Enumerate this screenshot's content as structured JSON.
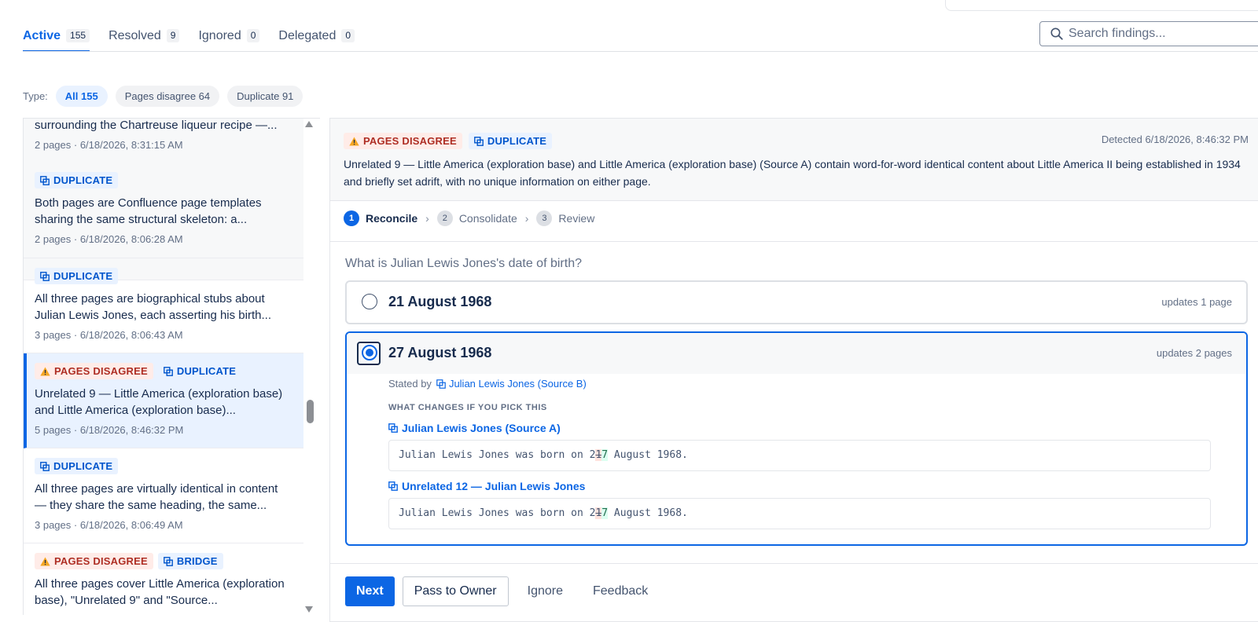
{
  "tabs": [
    {
      "label": "Active",
      "count": "155"
    },
    {
      "label": "Resolved",
      "count": "9"
    },
    {
      "label": "Ignored",
      "count": "0"
    },
    {
      "label": "Delegated",
      "count": "0"
    }
  ],
  "search": {
    "placeholder": "Search findings...",
    "icon": "search-icon"
  },
  "filter": {
    "label": "Type:",
    "chips": [
      "All 155",
      "Pages disagree 64",
      "Duplicate 91"
    ]
  },
  "badges": {
    "duplicate": "DUPLICATE",
    "pages_disagree": "PAGES DISAGREE",
    "bridge": "BRIDGE"
  },
  "list": {
    "items": [
      {
        "text": "surrounding the Chartreuse liqueur recipe —...",
        "meta": "2 pages · 6/18/2026, 8:31:15 AM"
      },
      {
        "text": "Both pages are Confluence page templates sharing the same structural skeleton: a...",
        "meta": "2 pages · 6/18/2026, 8:06:28 AM"
      },
      {
        "text": "All three pages are biographical stubs about Julian Lewis Jones, each asserting his birth...",
        "meta": "3 pages · 6/18/2026, 8:06:43 AM"
      },
      {
        "text": "Unrelated 9 — Little America (exploration base) and Little America (exploration base)...",
        "meta": "5 pages · 6/18/2026, 8:46:32 PM"
      },
      {
        "text": "All three pages are virtually identical in content — they share the same heading, the same...",
        "meta": "3 pages · 6/18/2026, 8:06:49 AM"
      },
      {
        "text": "All three pages cover Little America (exploration base), \"Unrelated 9\" and \"Source...",
        "meta": ""
      }
    ]
  },
  "detail": {
    "detected": "Detected 6/18/2026, 8:46:32 PM",
    "summary": "Unrelated 9 — Little America (exploration base) and Little America (exploration base) (Source A) contain word-for-word identical content about Little America II being established in 1934 and briefly set adrift, with no unique information on either page.",
    "steps": [
      {
        "num": "1",
        "label": "Reconcile"
      },
      {
        "num": "2",
        "label": "Consolidate"
      },
      {
        "num": "3",
        "label": "Review"
      }
    ],
    "question": "What is Julian Lewis Jones's date of birth?",
    "options": [
      {
        "label": "21 August 1968",
        "updates": "updates 1 page",
        "selected": false
      },
      {
        "label": "27 August 1968",
        "updates": "updates 2 pages",
        "selected": true
      }
    ],
    "stated_by_label": "Stated by",
    "stated_by_source": "Julian Lewis Jones (Source B)",
    "what_changes_heading": "WHAT CHANGES IF YOU PICK THIS",
    "changes": [
      {
        "title": "Julian Lewis Jones (Source A)",
        "before": "Julian Lewis Jones was born on 2",
        "removed": "1",
        "added": "7",
        "after": " August 1968."
      },
      {
        "title": "Unrelated 12 — Julian Lewis Jones",
        "before": "Julian Lewis Jones was born on 2",
        "removed": "1",
        "added": "7",
        "after": " August 1968."
      }
    ]
  },
  "actions": {
    "next": "Next",
    "pass": "Pass to Owner",
    "ignore": "Ignore",
    "feedback": "Feedback"
  },
  "colors": {
    "accent": "#0c66e4",
    "danger": "#ae2e24",
    "warning": "#f5a623"
  }
}
